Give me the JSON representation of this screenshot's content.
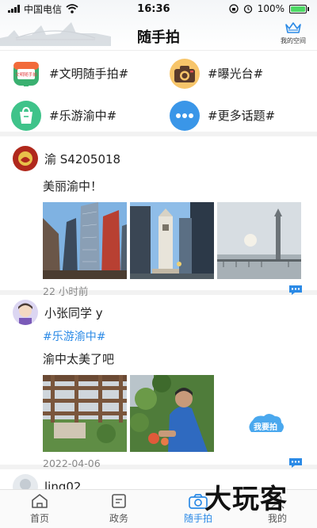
{
  "status_bar": {
    "carrier": "中国电信",
    "time": "16:36",
    "battery": "100%"
  },
  "header": {
    "title": "随手拍",
    "my_space_label": "我的空间"
  },
  "topics": [
    {
      "label": "#文明随手拍#",
      "icon": "civilization-photo-icon",
      "color": "#f0a020",
      "badge_text": "文明随手拍"
    },
    {
      "label": "#曝光台#",
      "icon": "camera-icon",
      "color": "#f2b640"
    },
    {
      "label": "#乐游渝中#",
      "icon": "shopping-bag-icon",
      "color": "#3fc38a"
    },
    {
      "label": "#更多话题#",
      "icon": "more-icon",
      "color": "#3a96e8"
    }
  ],
  "posts": [
    {
      "username": "渝 S4205018",
      "hashtag": "",
      "text": "美丽渝中！",
      "time": "22 小时前",
      "photos": [
        "skyscrapers-photo",
        "monument-tower-photo",
        "hazy-riverfront-photo"
      ]
    },
    {
      "username": "小张同学 y",
      "hashtag": "#乐游渝中#",
      "text": "渝中太美了吧",
      "time": "2022-04-06",
      "photos": [
        "pergola-garden-photo",
        "gardener-pruning-photo"
      ]
    },
    {
      "username": "ling02",
      "hashtag": "",
      "text": "",
      "time": "",
      "photos": []
    }
  ],
  "fab": {
    "label": "我要拍"
  },
  "bottom_nav": [
    {
      "label": "首页",
      "icon": "home-icon",
      "active": false
    },
    {
      "label": "政务",
      "icon": "document-icon",
      "active": false
    },
    {
      "label": "随手拍",
      "icon": "camera-icon",
      "active": true
    },
    {
      "label": "我的",
      "icon": "user-icon",
      "active": false
    }
  ],
  "watermark": "大玩客",
  "colors": {
    "accent": "#2b8ae6",
    "hashtag": "#2b8ae6",
    "divider": "#f2f2f2"
  }
}
